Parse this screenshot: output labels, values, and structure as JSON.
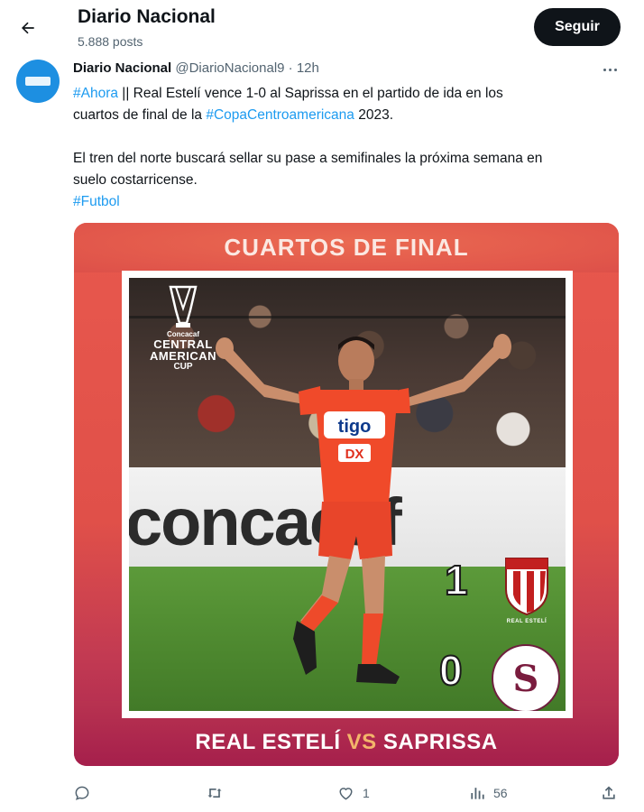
{
  "header": {
    "title": "Diario Nacional",
    "posts": "5.888 posts",
    "follow_label": "Seguir"
  },
  "tweet": {
    "author_name": "Diario Nacional",
    "author_handle": "@DiarioNacional9",
    "separator": "·",
    "time": "12h",
    "line1_tag": "#Ahora",
    "line1_text": " || Real Estelí vence 1-0 al Saprissa en el partido de ida en los",
    "line2_text": "cuartos de final de la ",
    "line2_tag": "#CopaCentroamericana",
    "line2_end": " 2023.",
    "para2_line1": "El tren del norte buscará sellar su pase a semifinales la próxima semana en",
    "para2_line2": "suelo costarricense.",
    "tag3": "#Futbol"
  },
  "media": {
    "top_title": "CUARTOS DE FINAL",
    "cup_small": "Concacaf",
    "cup_line1": "CENTRAL",
    "cup_line2": "AMERICAN",
    "cup_line3": "CUP",
    "board_text": "concacaf",
    "jersey_sponsor": "tigo",
    "jersey_sponsor2": "DX",
    "home_score": "1",
    "away_score": "0",
    "home_crest_label": "REAL ESTELÍ",
    "away_crest_letter": "S",
    "bottom_home": "REAL ESTELÍ",
    "bottom_vs": "VS",
    "bottom_away": "SAPRISSA"
  },
  "actions": {
    "reply_count": "",
    "repost_count": "",
    "like_count": "1",
    "views_count": "56"
  },
  "colors": {
    "link": "#1d9bf0",
    "muted": "#536471",
    "card_red": "#e05049",
    "card_wine": "#a51f4c",
    "vs_gold": "#f3b56a"
  }
}
